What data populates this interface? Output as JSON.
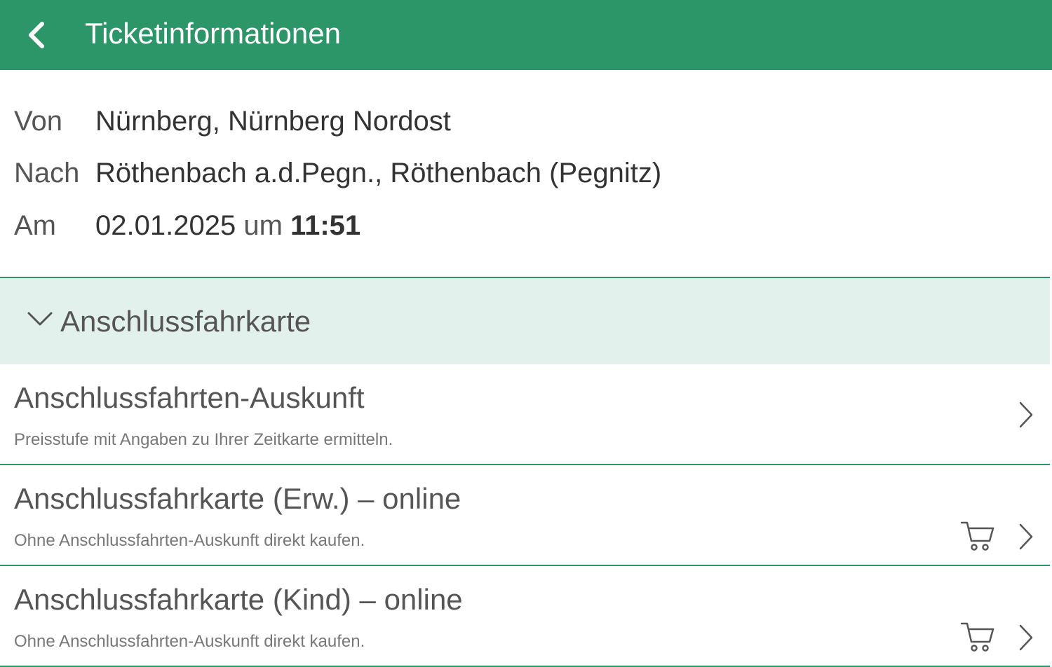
{
  "header": {
    "title": "Ticketinformationen",
    "back_icon": "chevron-left-icon",
    "background_color": "#2c9669"
  },
  "connection": {
    "from_label": "Von",
    "from_value": "Nürnberg, Nürnberg Nordost",
    "to_label": "Nach",
    "to_value": "Röthenbach a.d.Pegn., Röthenbach (Pegnitz)",
    "date_label": "Am",
    "date_value": "02.01.2025",
    "time_separator": "um",
    "time_value": "11:51"
  },
  "section": {
    "title": "Anschlussfahrkarte",
    "icon": "chevron-down-icon",
    "background_color": "#e2f1ec"
  },
  "items": [
    {
      "title": "Anschlussfahrten-Auskunft",
      "subtitle": "Preisstufe mit Angaben zu Ihrer Zeitkarte ermitteln.",
      "icons": [
        "chevron-right-icon"
      ]
    },
    {
      "title": "Anschlussfahrkarte (Erw.) – online",
      "subtitle": "Ohne Anschlussfahrten-Auskunft direkt kaufen.",
      "icons": [
        "cart-icon",
        "chevron-right-icon"
      ]
    },
    {
      "title": "Anschlussfahrkarte (Kind) – online",
      "subtitle": "Ohne Anschlussfahrten-Auskunft direkt kaufen.",
      "icons": [
        "cart-icon",
        "chevron-right-icon"
      ]
    }
  ]
}
